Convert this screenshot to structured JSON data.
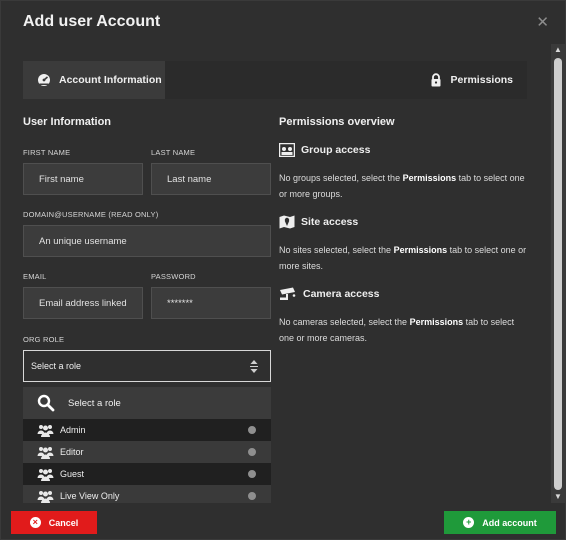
{
  "dialog": {
    "title": "Add user Account",
    "close_glyph": "✕"
  },
  "tabs": [
    {
      "label": "Account Information",
      "icon": "gauge-icon",
      "active": true
    },
    {
      "label": "Permissions",
      "icon": "lock-icon",
      "active": false
    }
  ],
  "user_info": {
    "heading": "User Information",
    "first_name": {
      "label": "FIRST NAME",
      "placeholder": "First name"
    },
    "last_name": {
      "label": "LAST NAME",
      "placeholder": "Last name"
    },
    "username": {
      "label": "DOMAIN@USERNAME (READ ONLY)",
      "placeholder": "An unique username"
    },
    "email": {
      "label": "EMAIL",
      "placeholder": "Email address linked"
    },
    "password": {
      "label": "PASSWORD",
      "value": "*******"
    },
    "org_role": {
      "label": "ORG ROLE",
      "selected": "Select a role"
    }
  },
  "role_dropdown": {
    "search_label": "Select a role",
    "options": [
      {
        "label": "Admin"
      },
      {
        "label": "Editor"
      },
      {
        "label": "Guest"
      },
      {
        "label": "Live View Only"
      }
    ]
  },
  "permissions_overview": {
    "heading": "Permissions overview",
    "group": {
      "title": "Group access",
      "text_before": "No groups selected, select the ",
      "link": "Permissions",
      "text_after": " tab to select one or more groups."
    },
    "site": {
      "title": "Site access",
      "text_before": "No sites selected, select the ",
      "link": "Permissions",
      "text_after": " tab to select one or more sites."
    },
    "camera": {
      "title": "Camera access",
      "text_before": "No cameras selected, select the ",
      "link": "Permissions",
      "text_after": " tab to select one or more cameras."
    }
  },
  "footer": {
    "cancel_label": "Cancel",
    "cancel_glyph": "×",
    "add_label": "Add account",
    "add_glyph": "+"
  },
  "colors": {
    "cancel": "#e11b1b",
    "add": "#1f9a3a",
    "background": "#2f2f2f"
  }
}
